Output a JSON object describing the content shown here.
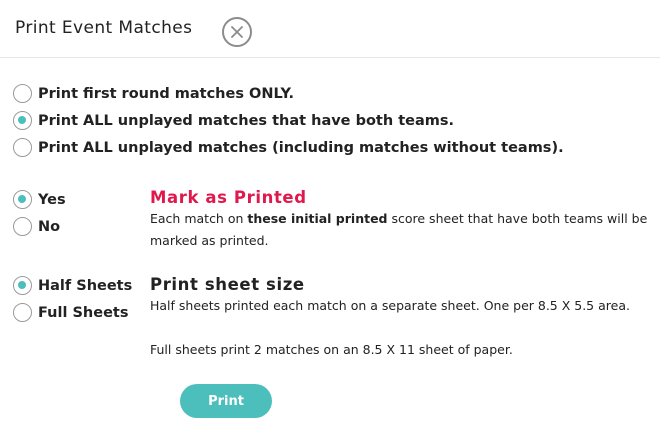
{
  "dialog": {
    "title": "Print Event Matches",
    "close_icon": "close-icon"
  },
  "print_scope": {
    "options": [
      {
        "label": "Print first round matches ONLY.",
        "checked": false
      },
      {
        "label": "Print ALL unplayed matches that have both teams.",
        "checked": true
      },
      {
        "label": "Print ALL unplayed matches (including matches without teams).",
        "checked": false
      }
    ]
  },
  "mark_printed": {
    "options": [
      {
        "label": "Yes",
        "checked": true
      },
      {
        "label": "No",
        "checked": false
      }
    ],
    "title": "Mark as Printed",
    "desc_prefix": "Each match on ",
    "desc_bold": "these initial printed",
    "desc_suffix": " score sheet that have both teams will be",
    "desc_line2": "marked as printed."
  },
  "sheet_size": {
    "options": [
      {
        "label": "Half Sheets",
        "checked": true
      },
      {
        "label": "Full Sheets",
        "checked": false
      }
    ],
    "title": "Print sheet size",
    "desc_line1": "Half sheets printed each match on a separate sheet. One per 8.5 X 5.5 area.",
    "desc_line2": "Full sheets print 2 matches on an 8.5 X 11 sheet of paper."
  },
  "actions": {
    "print_label": "Print"
  },
  "colors": {
    "accent": "#4cbfbc",
    "title_red": "#e0194d"
  }
}
